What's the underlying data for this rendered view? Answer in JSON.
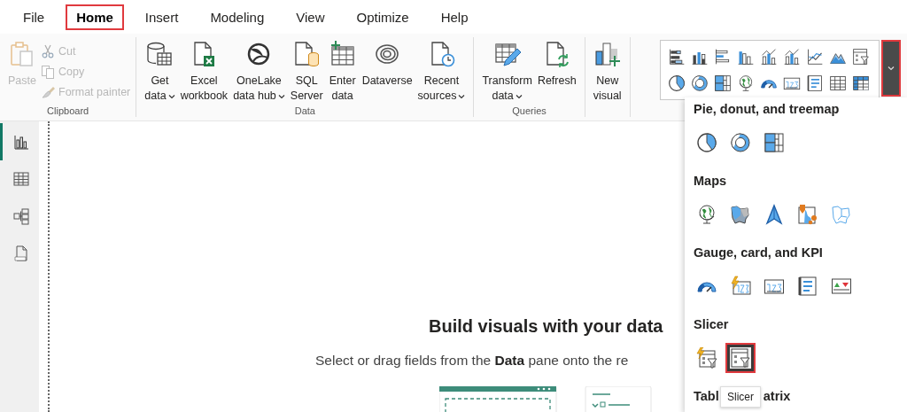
{
  "menu": {
    "tabs": [
      {
        "label": "File",
        "selected": false,
        "highlighted": false
      },
      {
        "label": "Home",
        "selected": true,
        "highlighted": true
      },
      {
        "label": "Insert",
        "selected": false,
        "highlighted": false
      },
      {
        "label": "Modeling",
        "selected": false,
        "highlighted": false
      },
      {
        "label": "View",
        "selected": false,
        "highlighted": false
      },
      {
        "label": "Optimize",
        "selected": false,
        "highlighted": false
      },
      {
        "label": "Help",
        "selected": false,
        "highlighted": false
      }
    ]
  },
  "ribbon": {
    "groups": [
      {
        "label": "Clipboard",
        "large": [
          {
            "lines": [
              "Paste"
            ],
            "dropdown": false,
            "disabled": true
          }
        ],
        "small": [
          {
            "label": "Cut",
            "disabled": true
          },
          {
            "label": "Copy",
            "disabled": true
          },
          {
            "label": "Format painter",
            "disabled": true
          }
        ]
      },
      {
        "label": "Data",
        "large": [
          {
            "lines": [
              "Get",
              "data"
            ],
            "dropdown": true,
            "disabled": false
          },
          {
            "lines": [
              "Excel",
              "workbook"
            ],
            "dropdown": false,
            "disabled": false
          },
          {
            "lines": [
              "OneLake",
              "data hub"
            ],
            "dropdown": true,
            "disabled": false
          },
          {
            "lines": [
              "SQL",
              "Server"
            ],
            "dropdown": false,
            "disabled": false
          },
          {
            "lines": [
              "Enter",
              "data"
            ],
            "dropdown": false,
            "disabled": false
          },
          {
            "lines": [
              "Dataverse"
            ],
            "dropdown": false,
            "disabled": false
          },
          {
            "lines": [
              "Recent",
              "sources"
            ],
            "dropdown": true,
            "disabled": false
          }
        ]
      },
      {
        "label": "Queries",
        "large": [
          {
            "lines": [
              "Transform",
              "data"
            ],
            "dropdown": true,
            "disabled": false
          },
          {
            "lines": [
              "Refresh"
            ],
            "dropdown": false,
            "disabled": false
          }
        ]
      },
      {
        "large": [
          {
            "lines": [
              "New",
              "visual"
            ],
            "dropdown": false,
            "disabled": false
          }
        ]
      }
    ],
    "gallery_more": {
      "highlighted": true
    }
  },
  "rail": {
    "views": [
      {
        "selected": true
      },
      {
        "selected": false
      },
      {
        "selected": false
      },
      {
        "selected": false
      }
    ]
  },
  "canvas": {
    "title": "Build visuals with your data",
    "hint": "Select or drag fields from the **Data** pane onto the re"
  },
  "visuals_panel": {
    "sections": [
      {
        "heading": "Pie, donut, and treemap",
        "items": [
          {
            "selected": false,
            "highlighted": false
          },
          {
            "selected": false,
            "highlighted": false
          },
          {
            "selected": false,
            "highlighted": false
          }
        ]
      },
      {
        "heading": "Maps",
        "items": [
          {
            "selected": false,
            "highlighted": false
          },
          {
            "selected": false,
            "highlighted": false
          },
          {
            "selected": false,
            "highlighted": false
          },
          {
            "selected": false,
            "highlighted": false
          },
          {
            "selected": false,
            "highlighted": false
          }
        ]
      },
      {
        "heading": "Gauge, card, and KPI",
        "items": [
          {
            "selected": false,
            "highlighted": false
          },
          {
            "selected": false,
            "highlighted": false
          },
          {
            "selected": false,
            "highlighted": false
          },
          {
            "selected": false,
            "highlighted": false
          },
          {
            "selected": false,
            "highlighted": false
          }
        ]
      },
      {
        "heading": "Slicer",
        "items": [
          {
            "selected": false,
            "highlighted": false
          },
          {
            "selected": true,
            "highlighted": true
          }
        ]
      },
      {
        "heading_parts": [
          "Tabl",
          "atrix"
        ]
      }
    ],
    "tooltip": "Slicer"
  }
}
